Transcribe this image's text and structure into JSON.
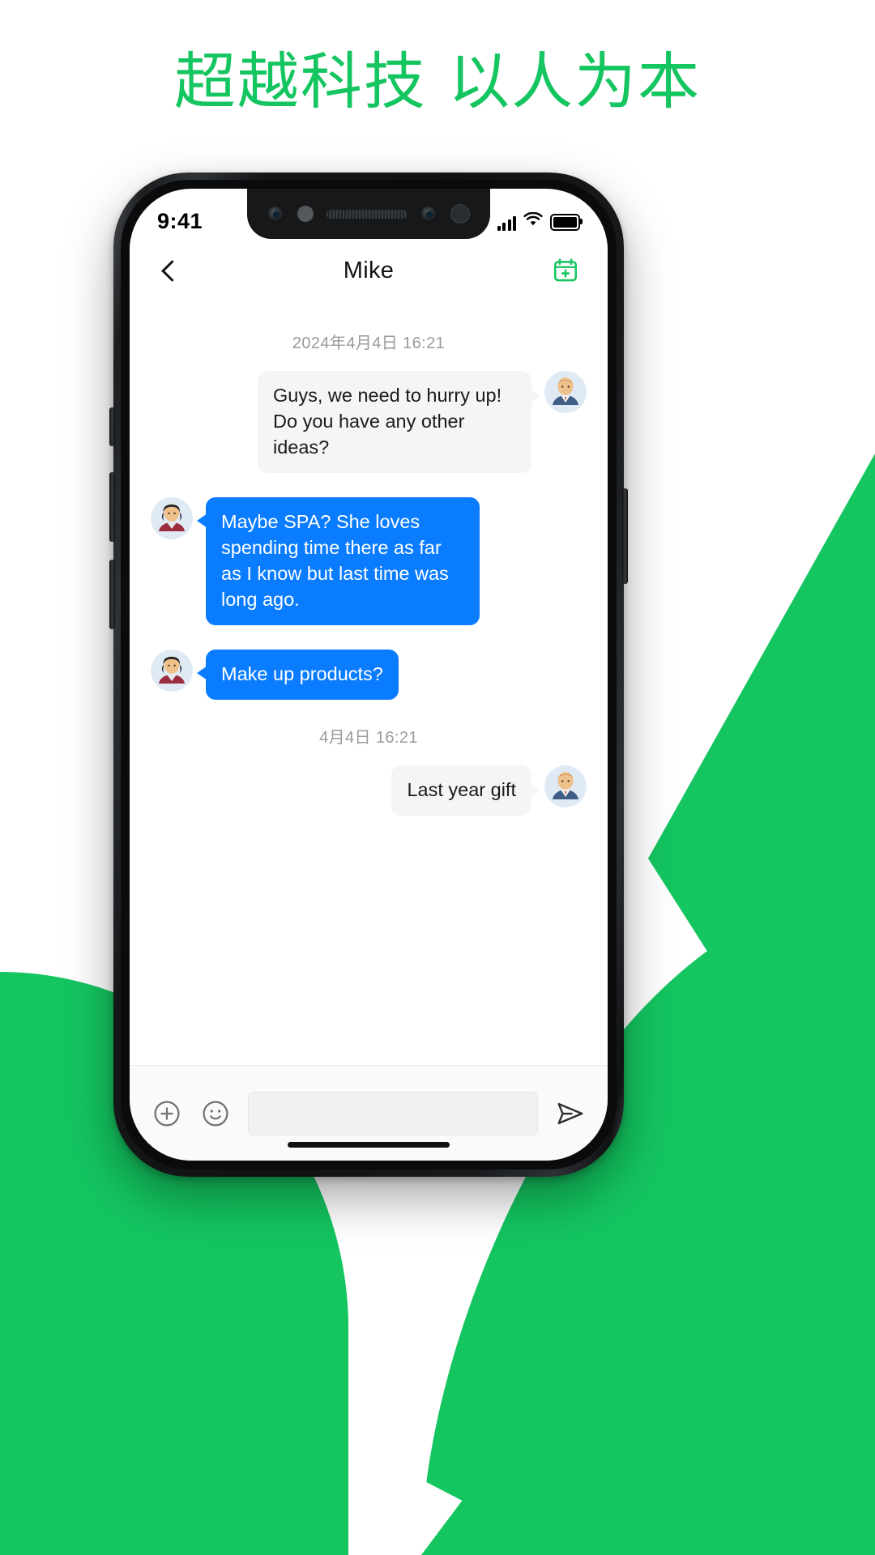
{
  "headline": {
    "text": "超越科技 以人为本",
    "color": "#14c560"
  },
  "brand": {
    "accent_green": "#14c560",
    "bubble_blue": "#0a7cff",
    "bubble_gray": "#f4f5f7"
  },
  "phone": {
    "status_bar": {
      "time": "9:41",
      "signal_icon": "cellular-signal-icon",
      "wifi_icon": "wifi-icon",
      "battery_icon": "battery-full-icon"
    },
    "chat_header": {
      "back_icon": "back-chevron-icon",
      "title": "Mike",
      "action_icon": "calendar-add-icon"
    },
    "conversation": [
      {
        "kind": "timestamp",
        "text": "2024年4月4日  16:21"
      },
      {
        "kind": "message",
        "side": "incoming",
        "text": "Guys, we need to hurry up! Do you have any other ideas?",
        "avatar": "man-avatar"
      },
      {
        "kind": "message",
        "side": "outgoing",
        "text": "Maybe SPA? She loves spending time there as far as I know but last time was long ago.",
        "avatar": "woman-avatar"
      },
      {
        "kind": "message",
        "side": "outgoing",
        "text": "Make up products?",
        "avatar": "woman-avatar"
      },
      {
        "kind": "timestamp",
        "text": "4月4日  16:21"
      },
      {
        "kind": "message",
        "side": "incoming",
        "text": "Last year gift",
        "avatar": "man-avatar"
      }
    ],
    "input_bar": {
      "add_icon": "plus-circle-icon",
      "emoji_icon": "smiley-face-icon",
      "placeholder": "",
      "value": "",
      "send_icon": "send-paper-plane-icon"
    },
    "home_indicator": "home-indicator-bar"
  }
}
